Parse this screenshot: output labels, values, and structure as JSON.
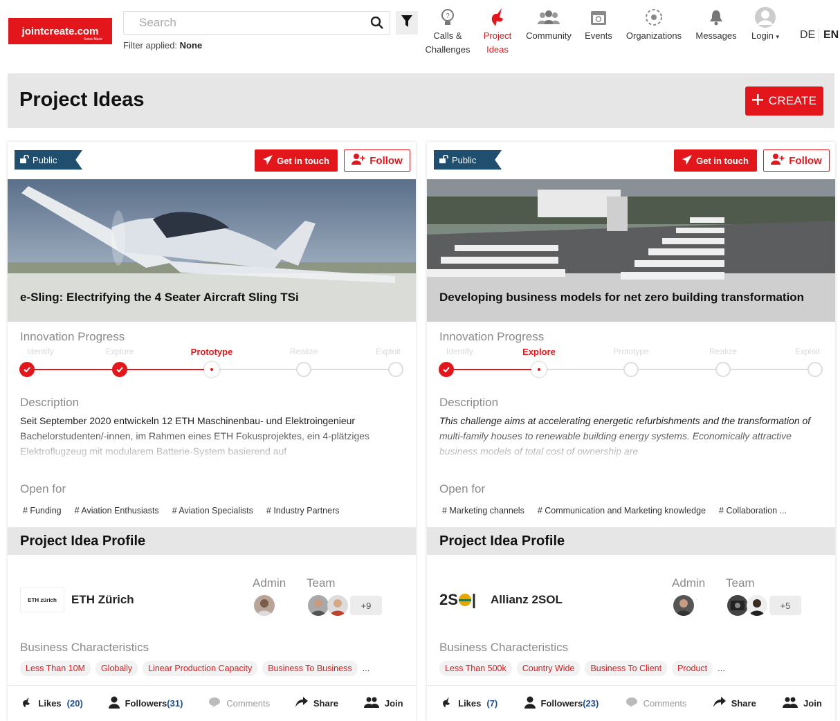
{
  "header": {
    "logo_text": "jointcreate.com",
    "logo_sub": "Swiss Made",
    "search_placeholder": "Search",
    "filter_label": "Filter applied:",
    "filter_value": "None",
    "nav": [
      {
        "line1": "Calls &",
        "line2": "Challenges",
        "icon": "lightbulb-icon"
      },
      {
        "line1": "Project",
        "line2": "Ideas",
        "icon": "unicorn-icon",
        "active": true
      },
      {
        "line1": "Community",
        "line2": "",
        "icon": "people-icon"
      },
      {
        "line1": "Events",
        "line2": "",
        "icon": "calendar-icon"
      },
      {
        "line1": "Organizations",
        "line2": "",
        "icon": "organization-icon"
      },
      {
        "line1": "Messages",
        "line2": "",
        "icon": "bell-icon"
      },
      {
        "line1": "Login",
        "line2": "",
        "icon": "avatar-icon"
      }
    ],
    "lang_de": "DE",
    "lang_en": "EN"
  },
  "page": {
    "title": "Project Ideas",
    "create_label": "CREATE"
  },
  "colors": {
    "accent": "#e3161b",
    "badge": "#1f4e6e"
  },
  "cards": [
    {
      "visibility": "Public",
      "get_in_touch": "Get in touch",
      "follow": "Follow",
      "title": "e-Sling: Electrifying the 4 Seater Aircraft Sling TSi",
      "progress_label": "Innovation Progress",
      "stages": [
        "Identify",
        "Explore",
        "Prototype",
        "Realize",
        "Exploit"
      ],
      "current_stage": 2,
      "description_label": "Description",
      "description": "Seit September 2020 entwickeln 12 ETH Maschinenbau- und Elektroingenieur Bachelorstudenten/-innen, im Rahmen eines ETH Fokusprojektes, ein 4-plätziges Elektroflugzeug mit modularem Batterie-System basierend auf",
      "open_for_label": "Open for",
      "open_for": [
        "# Funding",
        "# Aviation Enthusiasts",
        "# Aviation Specialists",
        "# Industry Partners"
      ],
      "profile_label": "Project Idea Profile",
      "org_name": "ETH Zürich",
      "org_logo_text": "ETH zürich",
      "admin_label": "Admin",
      "team_label": "Team",
      "team_more": "+9",
      "business_label": "Business Characteristics",
      "business": [
        "Less Than 10M",
        "Globally",
        "Linear Production Capacity",
        "Business To Business"
      ],
      "likes_label": "Likes",
      "likes": "(20)",
      "followers_label": "Followers",
      "followers": "(31)",
      "comments_label": "Comments",
      "share_label": "Share",
      "join_label": "Join"
    },
    {
      "visibility": "Public",
      "get_in_touch": "Get in touch",
      "follow": "Follow",
      "title": "Developing business models for net zero building transformation",
      "progress_label": "Innovation Progress",
      "stages": [
        "Identify",
        "Explore",
        "Prototype",
        "Realize",
        "Exploit"
      ],
      "current_stage": 1,
      "description_label": "Description",
      "description": "This challenge aims at accelerating energetic refurbishments and the transformation of multi-family houses to renewable building energy systems. Economically attractive business models of total cost of ownership are",
      "open_for_label": "Open for",
      "open_for": [
        "# Marketing channels",
        "# Communication and Marketing knowledge",
        "# Collaboration ..."
      ],
      "profile_label": "Project Idea Profile",
      "org_name": "Allianz 2SOL",
      "org_logo_text": "2S",
      "admin_label": "Admin",
      "team_label": "Team",
      "team_more": "+5",
      "business_label": "Business Characteristics",
      "business": [
        "Less Than 500k",
        "Country Wide",
        "Business To Client",
        "Product"
      ],
      "likes_label": "Likes",
      "likes": "(7)",
      "followers_label": "Followers",
      "followers": "(23)",
      "comments_label": "Comments",
      "share_label": "Share",
      "join_label": "Join"
    }
  ]
}
